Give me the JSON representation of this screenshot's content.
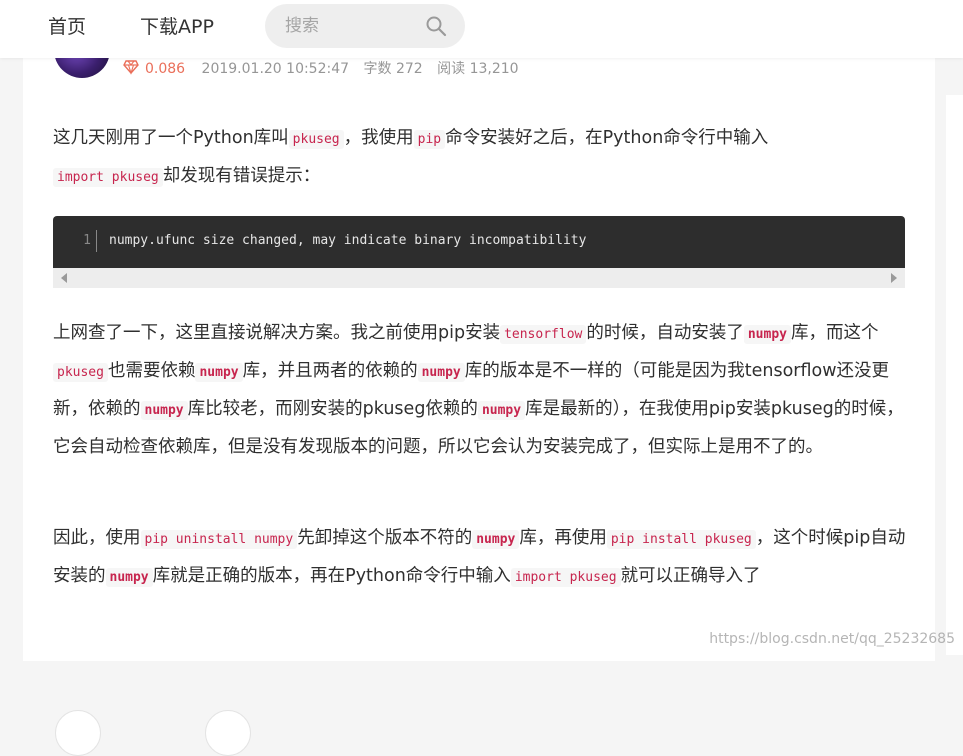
{
  "nav": {
    "home": "首页",
    "download_app": "下载APP",
    "search_placeholder": "搜索"
  },
  "meta": {
    "diamonds": "0.086",
    "datetime": "2019.01.20 10:52:47",
    "word_count": "字数 272",
    "reads": "阅读 13,210"
  },
  "article": {
    "p1": {
      "t1": "这几天刚用了一个Python库叫",
      "c1": "pkuseg",
      "t2": "，我使用",
      "c2": "pip",
      "t3": "命令安装好之后，在Python命令行中输入",
      "c3": "import pkuseg",
      "t4": "却发现有错误提示："
    },
    "code_block": {
      "line_number": "1",
      "code": "numpy.ufunc size changed, may indicate binary incompatibility"
    },
    "p2": {
      "t1": "上网查了一下，这里直接说解决方案。我之前使用pip安装",
      "c1": "tensorflow",
      "t2": "的时候，自动安装了",
      "c2": "numpy",
      "t3": "库，而这个",
      "c3": "pkuseg",
      "t4": "也需要依赖",
      "c4": "numpy",
      "t5": "库，并且两者的依赖的",
      "c5": "numpy",
      "t6": "库的版本是不一样的（可能是因为我tensorflow还没更新，依赖的",
      "c6": "numpy",
      "t7": "库比较老，而刚安装的pkuseg依赖的",
      "c7": "numpy",
      "t8": "库是最新的），在我使用pip安装pkuseg的时候，它会自动检查依赖库，但是没有发现版本的问题，所以它会认为安装完成了，但实际上是用不了的。"
    },
    "p3": {
      "t1": "因此，使用",
      "c1": "pip uninstall numpy",
      "t2": "先卸掉这个版本不符的",
      "c2": "numpy",
      "t3": "库，再使用",
      "c3": "pip install pkuseg",
      "t4": "，这个时候pip自动安装的",
      "c4": "numpy",
      "t5": "库就是正确的版本，再在Python命令行中输入",
      "c5": "import pkuseg",
      "t6": "就可以正确导入了"
    }
  },
  "watermark": "https://blog.csdn.net/qq_25232685",
  "colors": {
    "accent_red": "#ea6f5a",
    "inline_code": "#c7254e",
    "code_bg": "#2d2d2d"
  }
}
